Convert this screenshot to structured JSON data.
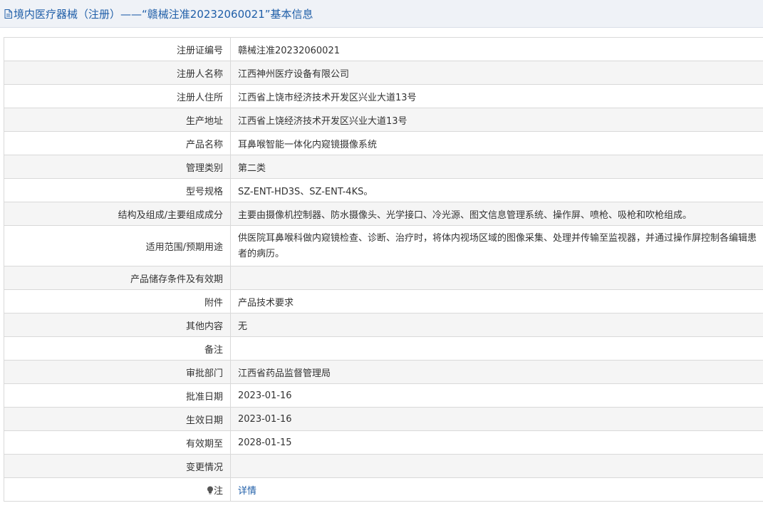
{
  "header": {
    "title": "境内医疗器械（注册）——“赣械注准20232060021”基本信息",
    "icon": "document-icon"
  },
  "rows": [
    {
      "label": "注册证编号",
      "value": "赣械注准20232060021"
    },
    {
      "label": "注册人名称",
      "value": "江西神州医疗设备有限公司"
    },
    {
      "label": "注册人住所",
      "value": "江西省上饶市经济技术开发区兴业大道13号"
    },
    {
      "label": "生产地址",
      "value": "江西省上饶经济技术开发区兴业大道13号"
    },
    {
      "label": "产品名称",
      "value": "耳鼻喉智能一体化内窥镜摄像系统"
    },
    {
      "label": "管理类别",
      "value": "第二类"
    },
    {
      "label": "型号规格",
      "value": "SZ-ENT-HD3S、SZ-ENT-4KS。"
    },
    {
      "label": "结构及组成/主要组成成分",
      "value": "主要由摄像机控制器、防水摄像头、光学接口、冷光源、图文信息管理系统、操作屏、喷枪、吸枪和吹枪组成。"
    },
    {
      "label": "适用范围/预期用途",
      "value": "供医院耳鼻喉科做内窥镜检查、诊断、治疗时，将体内视场区域的图像采集、处理并传输至监视器，并通过操作屏控制各编辑患者的病历。"
    },
    {
      "label": "产品储存条件及有效期",
      "value": ""
    },
    {
      "label": "附件",
      "value": "产品技术要求"
    },
    {
      "label": "其他内容",
      "value": "无"
    },
    {
      "label": "备注",
      "value": ""
    },
    {
      "label": "审批部门",
      "value": "江西省药品监督管理局"
    },
    {
      "label": "批准日期",
      "value": "2023-01-16"
    },
    {
      "label": "生效日期",
      "value": "2023-01-16"
    },
    {
      "label": "有效期至",
      "value": "2028-01-15"
    },
    {
      "label": "变更情况",
      "value": ""
    },
    {
      "label": "注",
      "value": "详情",
      "label_icon": "lightbulb-icon"
    }
  ],
  "colors": {
    "title_text": "#1f5ea8",
    "title_bg": "#eff2f7",
    "alt_row_bg": "#f5f5f5",
    "border": "#d9d9d9",
    "link": "#1f5ea8"
  }
}
